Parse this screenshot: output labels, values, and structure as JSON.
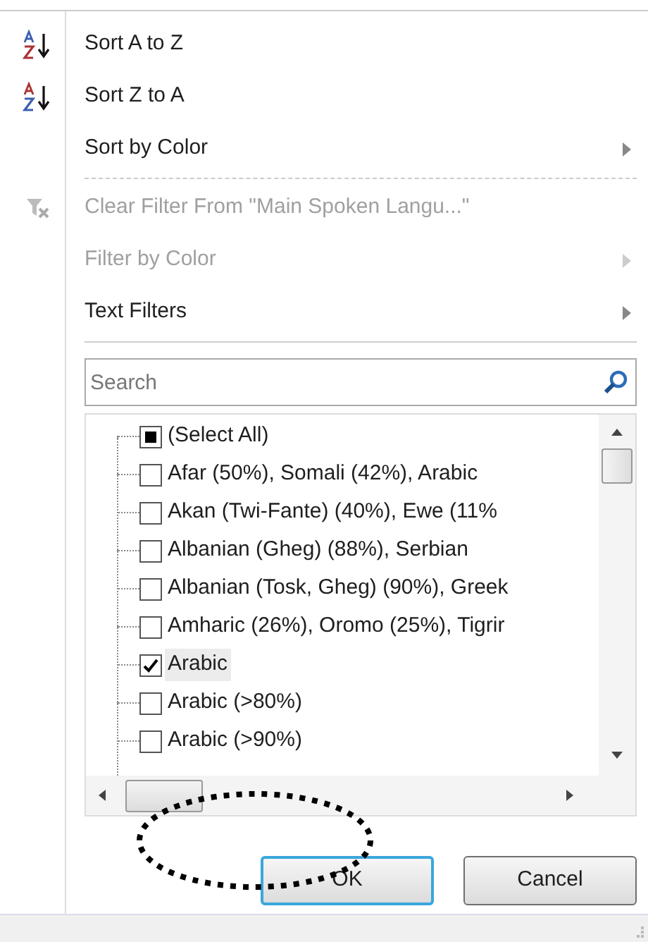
{
  "menu": [
    {
      "kind": "item",
      "label": "Sort A to Z",
      "disabled": false,
      "submenu": false
    },
    {
      "kind": "item",
      "label": "Sort Z to A",
      "disabled": false,
      "submenu": false
    },
    {
      "kind": "item",
      "label": "Sort by Color",
      "disabled": false,
      "submenu": true
    },
    {
      "kind": "dashed-separator"
    },
    {
      "kind": "item",
      "label": "Clear Filter From \"Main Spoken Langu...\"",
      "disabled": true,
      "submenu": false
    },
    {
      "kind": "item",
      "label": "Filter by Color",
      "disabled": true,
      "submenu": true
    },
    {
      "kind": "item",
      "label": "Text Filters",
      "disabled": false,
      "submenu": true
    },
    {
      "kind": "separator"
    }
  ],
  "search": {
    "placeholder": "Search"
  },
  "tree": [
    {
      "label": "(Select All)",
      "checked": false,
      "mixed": true,
      "selected": false
    },
    {
      "label": "Afar (50%), Somali (42%), Arabic",
      "checked": false,
      "mixed": false,
      "selected": false
    },
    {
      "label": "Akan (Twi-Fante) (40%), Ewe (11%",
      "checked": false,
      "mixed": false,
      "selected": false
    },
    {
      "label": "Albanian (Gheg) (88%), Serbian",
      "checked": false,
      "mixed": false,
      "selected": false
    },
    {
      "label": "Albanian (Tosk, Gheg) (90%), Greek",
      "checked": false,
      "mixed": false,
      "selected": false
    },
    {
      "label": "Amharic (26%), Oromo (25%), Tigrir",
      "checked": false,
      "mixed": false,
      "selected": false
    },
    {
      "label": "Arabic",
      "checked": true,
      "mixed": false,
      "selected": true
    },
    {
      "label": "Arabic (>80%)",
      "checked": false,
      "mixed": false,
      "selected": false
    },
    {
      "label": "Arabic (>90%)",
      "checked": false,
      "mixed": false,
      "selected": false
    }
  ],
  "buttons": [
    {
      "label": "OK",
      "default": true
    },
    {
      "label": "Cancel",
      "default": false
    }
  ],
  "annotation": {
    "kind": "dotted-ellipse"
  }
}
